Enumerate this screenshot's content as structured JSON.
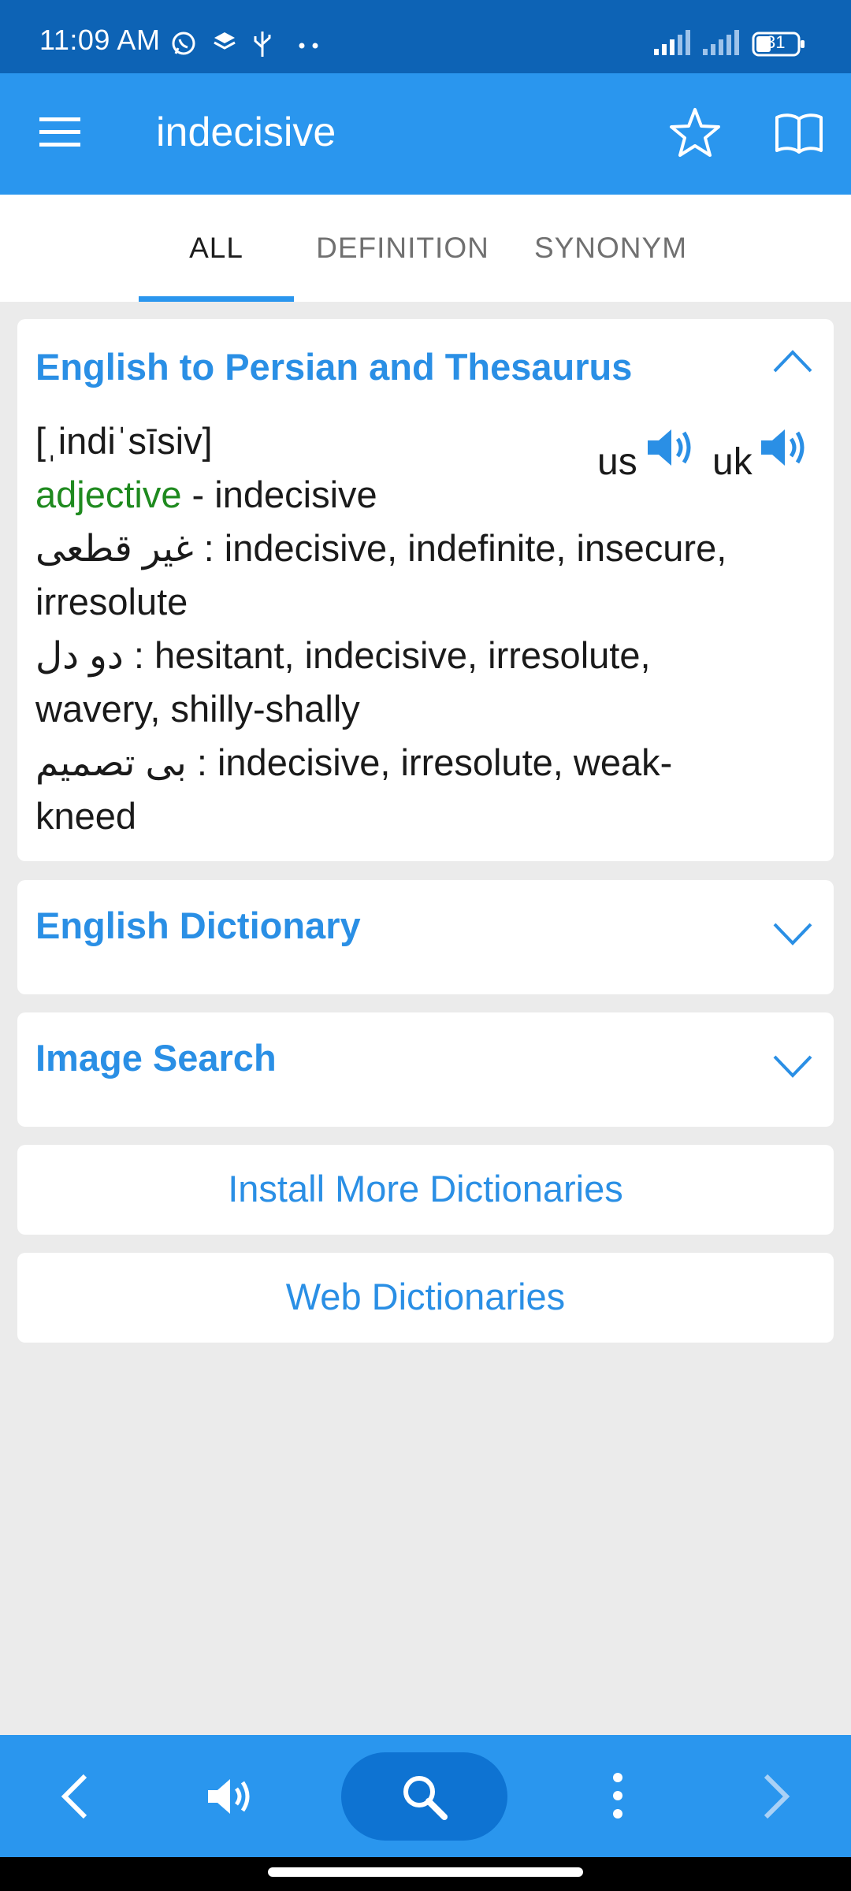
{
  "status_bar": {
    "time": "11:09 AM",
    "battery": "31",
    "icons": [
      "whatsapp-icon",
      "layers-icon",
      "usb-icon",
      "more-dots-icon",
      "signal-icon",
      "signal-icon",
      "battery-icon"
    ]
  },
  "app_bar": {
    "title": "indecisive",
    "icons": [
      "menu-icon",
      "star-icon",
      "book-icon"
    ]
  },
  "tabs": [
    {
      "label": "ALL",
      "active": true
    },
    {
      "label": "DEFINITION",
      "active": false
    },
    {
      "label": "SYNONYM",
      "active": false
    }
  ],
  "translation_card": {
    "title": "English to Persian and Thesaurus",
    "pronunciation": "[ˌindiˈsīsiv]",
    "us_label": "us",
    "uk_label": "uk",
    "part_of_speech": "adjective",
    "headword_line": " - indecisive",
    "entries": [
      {
        "persian": "غیر قطعی",
        "line1": " : indecisive, indefinite, insecure,",
        "line2": "irresolute"
      },
      {
        "persian": "دو دل",
        "line1": " : hesitant, indecisive, irresolute,",
        "line2": "wavery, shilly-shally"
      },
      {
        "persian": "بی تصمیم",
        "line1": " : indecisive, irresolute, weak-",
        "line2": "kneed"
      }
    ]
  },
  "english_dictionary_card": {
    "title": "English Dictionary"
  },
  "image_search_card": {
    "title": "Image Search"
  },
  "install_more": {
    "label": "Install More Dictionaries"
  },
  "web_dictionaries": {
    "label": "Web Dictionaries"
  },
  "bottom_bar": {
    "icons": [
      "back-arrow-icon",
      "speaker-icon",
      "search-icon",
      "more-vert-icon",
      "forward-arrow-icon"
    ]
  },
  "colors": {
    "primary": "#2a96ee",
    "status_bar": "#0d63b5",
    "link_blue": "#2a8fe5",
    "pos_green": "#1f8a1f",
    "background": "#ebebeb"
  }
}
